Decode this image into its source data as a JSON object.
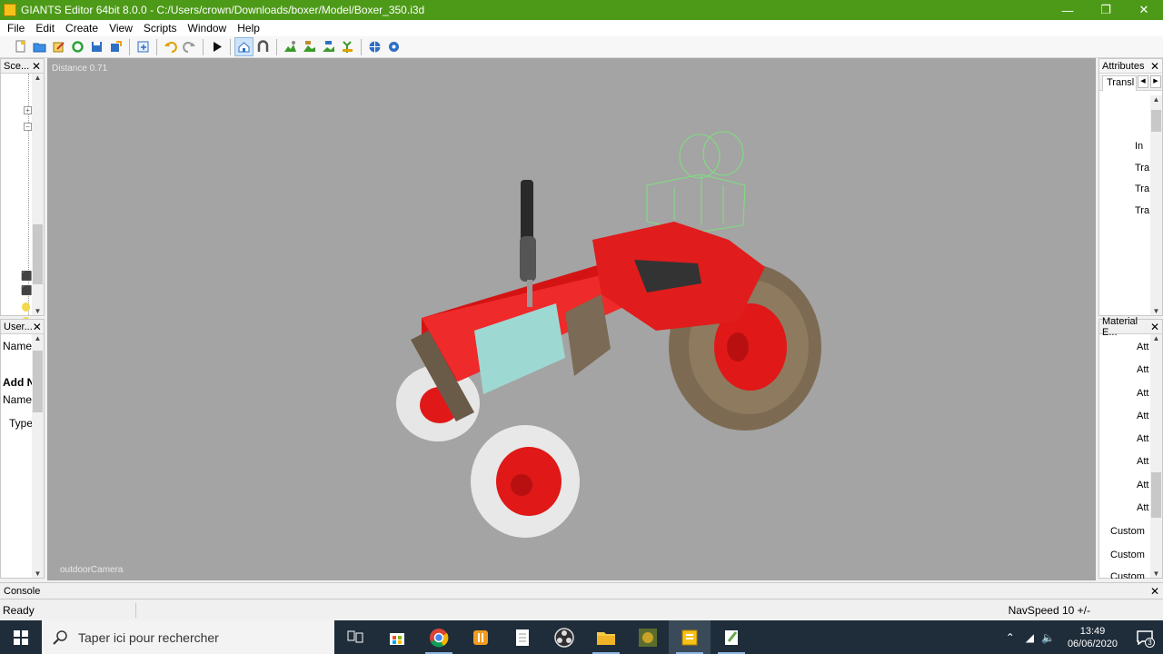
{
  "window": {
    "title": "GIANTS Editor 64bit 8.0.0 - C:/Users/crown/Downloads/boxer/Model/Boxer_350.i3d",
    "minimize": "—",
    "restore": "❐",
    "close": "✕"
  },
  "menu": {
    "items": [
      "File",
      "Edit",
      "Create",
      "View",
      "Scripts",
      "Window",
      "Help"
    ]
  },
  "scenegraph": {
    "title": "Sce...",
    "close": "✕"
  },
  "userattributes": {
    "title": "User...",
    "close": "✕",
    "name_label": "Name",
    "add_label": "Add N",
    "name2_label": "Name",
    "type_label": "Type"
  },
  "viewport": {
    "distance": "Distance 0.71",
    "camera": "outdoorCamera"
  },
  "attributes": {
    "title": "Attributes",
    "close": "✕",
    "tab": "Transl",
    "rows": [
      "In",
      "Tra",
      "Tra",
      "Tra"
    ]
  },
  "material": {
    "title": "Material E...",
    "close": "✕",
    "rows": [
      "Att",
      "Att",
      "Att",
      "Att",
      "Att",
      "Att",
      "Att",
      "Att",
      "Custom",
      "Custom",
      "Custom"
    ]
  },
  "console": {
    "title": "Console",
    "close": "✕"
  },
  "status": {
    "left": "Ready",
    "right": "NavSpeed 10 +/-"
  },
  "taskbar": {
    "search_placeholder": "Taper ici pour rechercher",
    "time": "13:49",
    "date": "06/06/2020",
    "notifications": "3"
  }
}
